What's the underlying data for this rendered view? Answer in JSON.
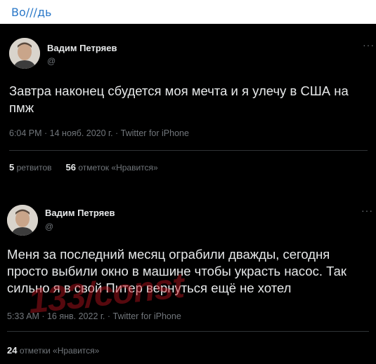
{
  "caption": "Во///дь",
  "tweets": [
    {
      "author": "Вадим Петряев",
      "handle": "@",
      "more": "···",
      "text": "Завтра наконец сбудется моя мечта и я улечу в США на пмж",
      "meta": "6:04 PM · 14 нояб. 2020 г. · Twitter for iPhone",
      "retweets_count": "5",
      "retweets_label": "ретвитов",
      "likes_count": "56",
      "likes_label": "отметок «Нравится»"
    },
    {
      "author": "Вадим Петряев",
      "handle": "@",
      "more": "···",
      "text": "Меня за последний месяц ограбили дважды, сегодня просто выбили окно в машине чтобы украсть насос. Так сильно я в свой Питер вернуться ещё не хотел",
      "meta": "5:33 AM · 16 янв. 2022 г. · Twitter for iPhone",
      "likes_count": "24",
      "likes_label": "отметки «Нравится»"
    }
  ],
  "watermark": "133/const"
}
